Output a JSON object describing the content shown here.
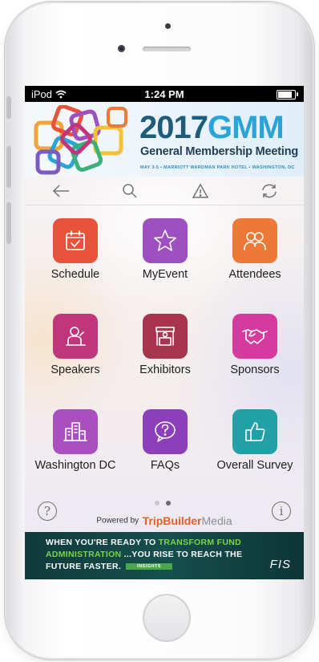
{
  "status_bar": {
    "carrier": "iPod",
    "time": "1:24 PM"
  },
  "banner": {
    "year": "2017",
    "acronym": "GMM",
    "subtitle": "General Membership Meeting",
    "dates_location": "MAY 3-5 • MARRIOTT WARDMAN PARK HOTEL • WASHINGTON, DC"
  },
  "toolbar": {
    "back_icon": "arrow-left-icon",
    "search_icon": "search-icon",
    "alert_icon": "warning-triangle-icon",
    "refresh_icon": "refresh-icon"
  },
  "tiles": [
    {
      "label": "Schedule",
      "color": "#e8523a",
      "icon": "calendar-check-icon"
    },
    {
      "label": "MyEvent",
      "color": "#9e4fc0",
      "icon": "star-icon"
    },
    {
      "label": "Attendees",
      "color": "#ee7836",
      "icon": "people-icon"
    },
    {
      "label": "Speakers",
      "color": "#c0367a",
      "icon": "speaker-podium-icon"
    },
    {
      "label": "Exhibitors",
      "color": "#a8344e",
      "icon": "booth-icon"
    },
    {
      "label": "Sponsors",
      "color": "#d63a9e",
      "icon": "handshake-icon"
    },
    {
      "label": "Washington DC",
      "color": "#a94fc0",
      "icon": "city-icon"
    },
    {
      "label": "FAQs",
      "color": "#8c3fb8",
      "icon": "question-bubble-icon"
    },
    {
      "label": "Overall Survey",
      "color": "#22a0a8",
      "icon": "thumbs-up-icon"
    }
  ],
  "pager": {
    "total": 2,
    "active": 2
  },
  "footer": {
    "help_symbol": "?",
    "info_symbol": "i",
    "powered_by": "Powered by",
    "brand_part1": "TripBuilder",
    "brand_part2": "Media"
  },
  "ad": {
    "line1_pre": "WHEN YOU'RE READY TO ",
    "line1_hl": "TRANSFORM FUND",
    "line2_hl": "ADMINISTRATION",
    "line2_post": " ...YOU RISE TO REACH THE",
    "line3": "FUTURE FASTER.",
    "badge": "INSIGHTS",
    "brand": "FIS"
  }
}
